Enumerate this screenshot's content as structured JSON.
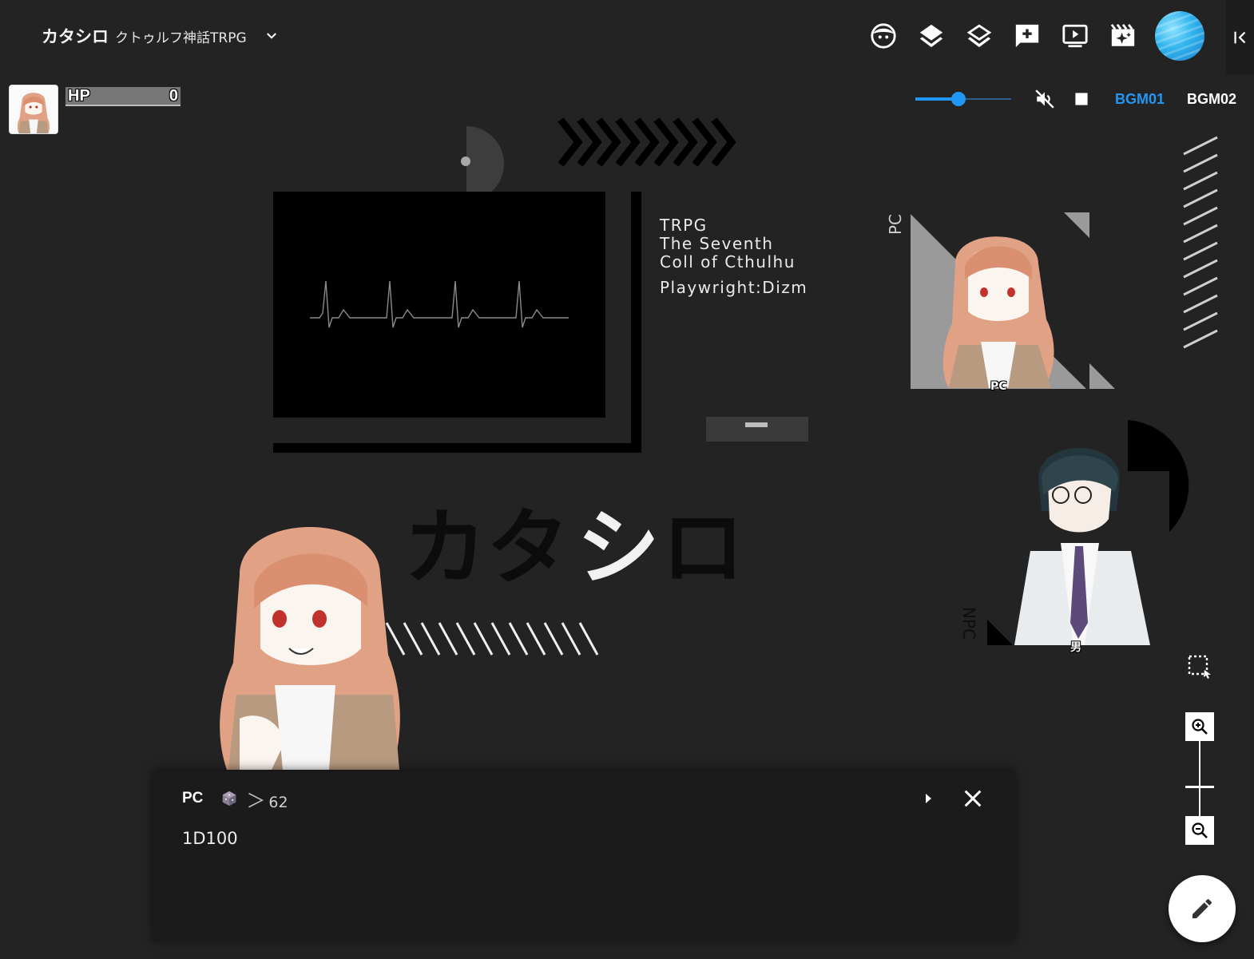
{
  "header": {
    "room_name": "カタシロ",
    "room_subtitle": "クトゥルフ神話TRPG",
    "toolbar_icons": [
      "face-icon",
      "layers-filled-icon",
      "layers-outline-icon",
      "add-comment-icon",
      "slideshow-icon",
      "video-effects-icon"
    ]
  },
  "token": {
    "hp_label": "HP",
    "hp_value": "0"
  },
  "bgm": {
    "volume": 0.45,
    "tabs": [
      {
        "label": "BGM01",
        "active": true
      },
      {
        "label": "BGM02",
        "active": false
      }
    ],
    "active_color": "#2196f3"
  },
  "board": {
    "info_line1": "TRPG",
    "info_line2": "The Seventh",
    "info_line3": "Coll of Cthulhu",
    "info_line4": "Playwright:Dizm",
    "side_label_pc": "PC",
    "side_label_npc": "NPC",
    "title": "カタシロ",
    "card_pc_label": "PC",
    "card_npc_label": "男"
  },
  "chat": {
    "name": "PC",
    "result": "62",
    "input_value": "1D100"
  }
}
